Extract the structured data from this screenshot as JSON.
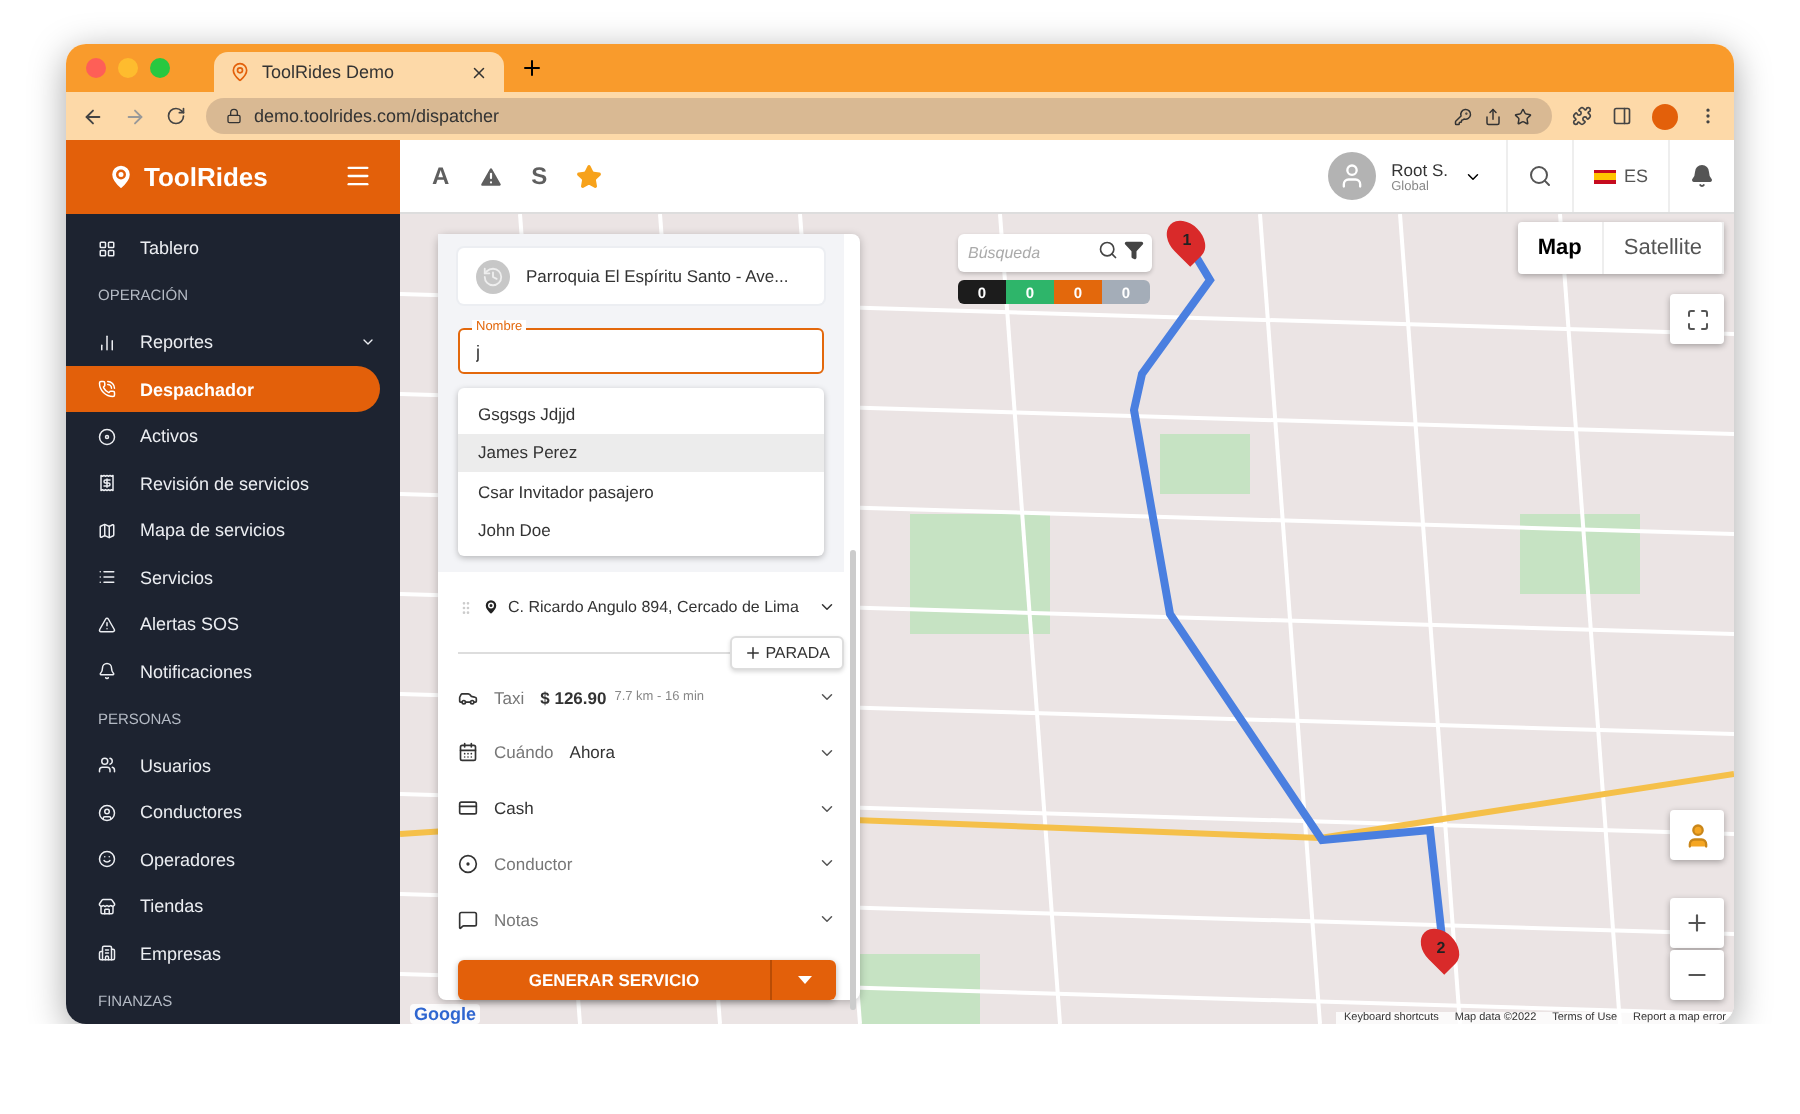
{
  "browser": {
    "tab_title": "ToolRides Demo",
    "url": "demo.toolrides.com/dispatcher"
  },
  "sidebar": {
    "brand": "ToolRides",
    "sections": [
      {
        "items": [
          {
            "label": "Tablero",
            "selected": false,
            "expandable": false
          }
        ]
      },
      {
        "heading": "OPERACIÓN",
        "items": [
          {
            "label": "Reportes",
            "selected": false,
            "expandable": true
          },
          {
            "label": "Despachador",
            "selected": true,
            "expandable": false
          },
          {
            "label": "Activos",
            "selected": false,
            "expandable": false
          },
          {
            "label": "Revisión de servicios",
            "selected": false,
            "expandable": false
          },
          {
            "label": "Mapa de servicios",
            "selected": false,
            "expandable": false
          },
          {
            "label": "Servicios",
            "selected": false,
            "expandable": false
          },
          {
            "label": "Alertas SOS",
            "selected": false,
            "expandable": false
          },
          {
            "label": "Notificaciones",
            "selected": false,
            "expandable": false
          }
        ]
      },
      {
        "heading": "PERSONAS",
        "items": [
          {
            "label": "Usuarios",
            "selected": false,
            "expandable": false
          },
          {
            "label": "Conductores",
            "selected": false,
            "expandable": false
          },
          {
            "label": "Operadores",
            "selected": false,
            "expandable": false
          },
          {
            "label": "Tiendas",
            "selected": false,
            "expandable": false
          },
          {
            "label": "Empresas",
            "selected": false,
            "expandable": false
          }
        ]
      },
      {
        "heading": "FINANZAS"
      }
    ]
  },
  "topbar": {
    "quick_actions": [
      {
        "kind": "letter",
        "label": "A"
      },
      {
        "kind": "alert"
      },
      {
        "kind": "letter",
        "label": "S"
      },
      {
        "kind": "favorite"
      }
    ],
    "user": {
      "name": "Root S.",
      "role": "Global"
    },
    "language": "ES"
  },
  "map": {
    "type_buttons": [
      {
        "label": "Map",
        "selected": true
      },
      {
        "label": "Satellite",
        "selected": false
      }
    ],
    "search": {
      "placeholder": "Búsqueda"
    },
    "counters": [
      {
        "value": "0",
        "color": "#1c1c1c"
      },
      {
        "value": "0",
        "color": "#2eb56a"
      },
      {
        "value": "0",
        "color": "#e3680c"
      },
      {
        "value": "0",
        "color": "#a4adb8"
      }
    ],
    "markers": [
      "1",
      "2"
    ],
    "logo": "Google",
    "footer": [
      "Keyboard shortcuts",
      "Map data ©2022",
      "Terms of Use",
      "Report a map error"
    ]
  },
  "panel": {
    "origin": "Parroquia El Espíritu Santo - Ave...",
    "name_field": {
      "label": "Nombre",
      "value": "j"
    },
    "suggestions": [
      {
        "label": "Gsgsgs Jdjjd",
        "selected": false
      },
      {
        "label": "James Perez",
        "selected": true
      },
      {
        "label": "Csar Invitador pasajero",
        "selected": false
      },
      {
        "label": "John Doe",
        "selected": false
      }
    ],
    "destination": "C. Ricardo Angulo 894, Cercado de Lima",
    "add_stop": "PARADA",
    "options": [
      {
        "kind": "vehicle",
        "label": "Taxi",
        "value": "$ 126.90",
        "detail": "7.7 km - 16 min"
      },
      {
        "kind": "schedule",
        "label": "Cuándo",
        "value": "Ahora"
      },
      {
        "kind": "payment",
        "value": "Cash"
      },
      {
        "kind": "driver",
        "label": "Conductor"
      },
      {
        "kind": "notes",
        "label": "Notas"
      }
    ],
    "submit": "GENERAR SERVICIO"
  }
}
